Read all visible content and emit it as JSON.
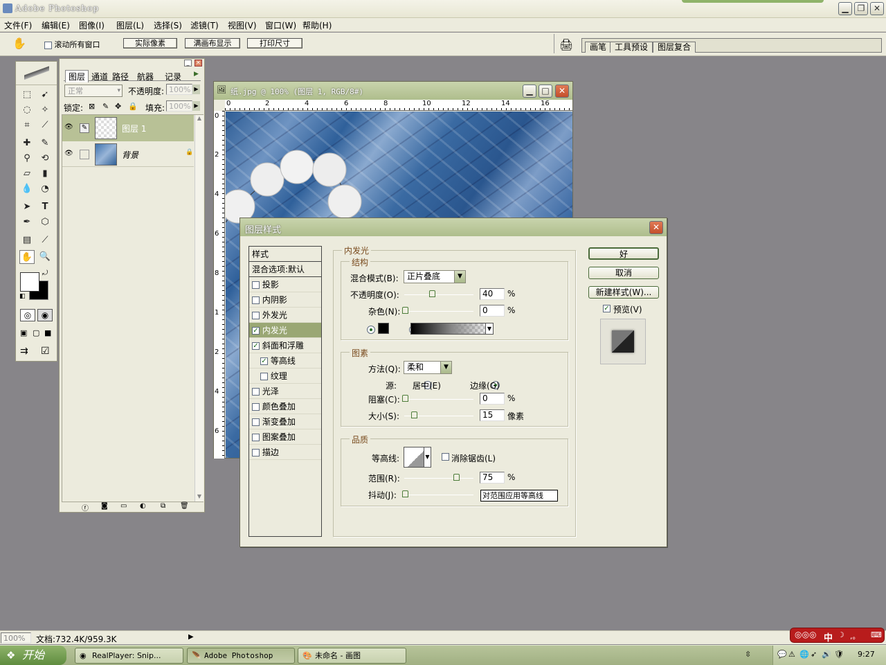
{
  "app": {
    "title": "Adobe Photoshop"
  },
  "menu": [
    "文件(F)",
    "编辑(E)",
    "图像(I)",
    "图层(L)",
    "选择(S)",
    "滤镜(T)",
    "视图(V)",
    "窗口(W)",
    "帮助(H)"
  ],
  "options_bar": {
    "checkbox_label": "滚动所有窗口",
    "buttons": [
      "实际像素",
      "满画布显示",
      "打印尺寸"
    ],
    "palette_tabs": [
      "画笔",
      "工具预设",
      "图层复合"
    ]
  },
  "layers_panel": {
    "tabs": [
      "图层",
      "通道",
      "路径",
      "航器",
      "记录"
    ],
    "blend_mode": "正常",
    "opacity_label": "不透明度:",
    "opacity_value": "100%",
    "lock_label": "锁定:",
    "fill_label": "填充:",
    "fill_value": "100%",
    "layers": [
      {
        "name": "图层 1"
      },
      {
        "name": "背景"
      }
    ]
  },
  "document": {
    "title": "纸.jpg @ 100% (图层 1, RGB/8#)",
    "ruler_top": [
      "0",
      "2",
      "4",
      "6",
      "8",
      "10",
      "12",
      "14",
      "16"
    ],
    "ruler_left": [
      "0",
      "2",
      "4",
      "6",
      "8",
      "1",
      "2",
      "4",
      "6"
    ]
  },
  "layer_style_dialog": {
    "title": "图层样式",
    "styles_header": "样式",
    "blend_options": "混合选项:默认",
    "styles": [
      {
        "label": "投影",
        "checked": false
      },
      {
        "label": "内阴影",
        "checked": false
      },
      {
        "label": "外发光",
        "checked": false
      },
      {
        "label": "内发光",
        "checked": true
      },
      {
        "label": "斜面和浮雕",
        "checked": true
      },
      {
        "label": "等高线",
        "checked": true
      },
      {
        "label": "纹理",
        "checked": false
      },
      {
        "label": "光泽",
        "checked": false
      },
      {
        "label": "颜色叠加",
        "checked": false
      },
      {
        "label": "渐变叠加",
        "checked": false
      },
      {
        "label": "图案叠加",
        "checked": false
      },
      {
        "label": "描边",
        "checked": false
      }
    ],
    "section_title": "内发光",
    "structure": {
      "title": "结构",
      "blend_mode_label": "混合模式(B):",
      "blend_mode_value": "正片叠底",
      "opacity_label": "不透明度(O):",
      "opacity_value": "40",
      "noise_label": "杂色(N):",
      "noise_value": "0",
      "percent": "%"
    },
    "elements": {
      "title": "图素",
      "method_label": "方法(Q):",
      "method_value": "柔和",
      "source_label": "源:",
      "source_center": "居中(E)",
      "source_edge": "边缘(G)",
      "choke_label": "阻塞(C):",
      "choke_value": "0",
      "size_label": "大小(S):",
      "size_value": "15",
      "size_unit": "像素"
    },
    "quality": {
      "title": "品质",
      "contour_label": "等高线:",
      "antialias_label": "消除锯齿(L)",
      "range_label": "范围(R):",
      "range_value": "75",
      "jitter_label": "抖动(J):",
      "jitter_tooltip": "对范围应用等高线"
    },
    "buttons": {
      "ok": "好",
      "cancel": "取消",
      "new_style": "新建样式(W)...",
      "preview": "预览(V)"
    }
  },
  "status": {
    "zoom": "100%",
    "doc": "文档:732.4K/959.3K"
  },
  "taskbar": {
    "start": "开始",
    "tasks": [
      "RealPlayer: Snip...",
      "Adobe Photoshop",
      "未命名 - 画图"
    ],
    "clock": "9:27",
    "ime": "中"
  }
}
